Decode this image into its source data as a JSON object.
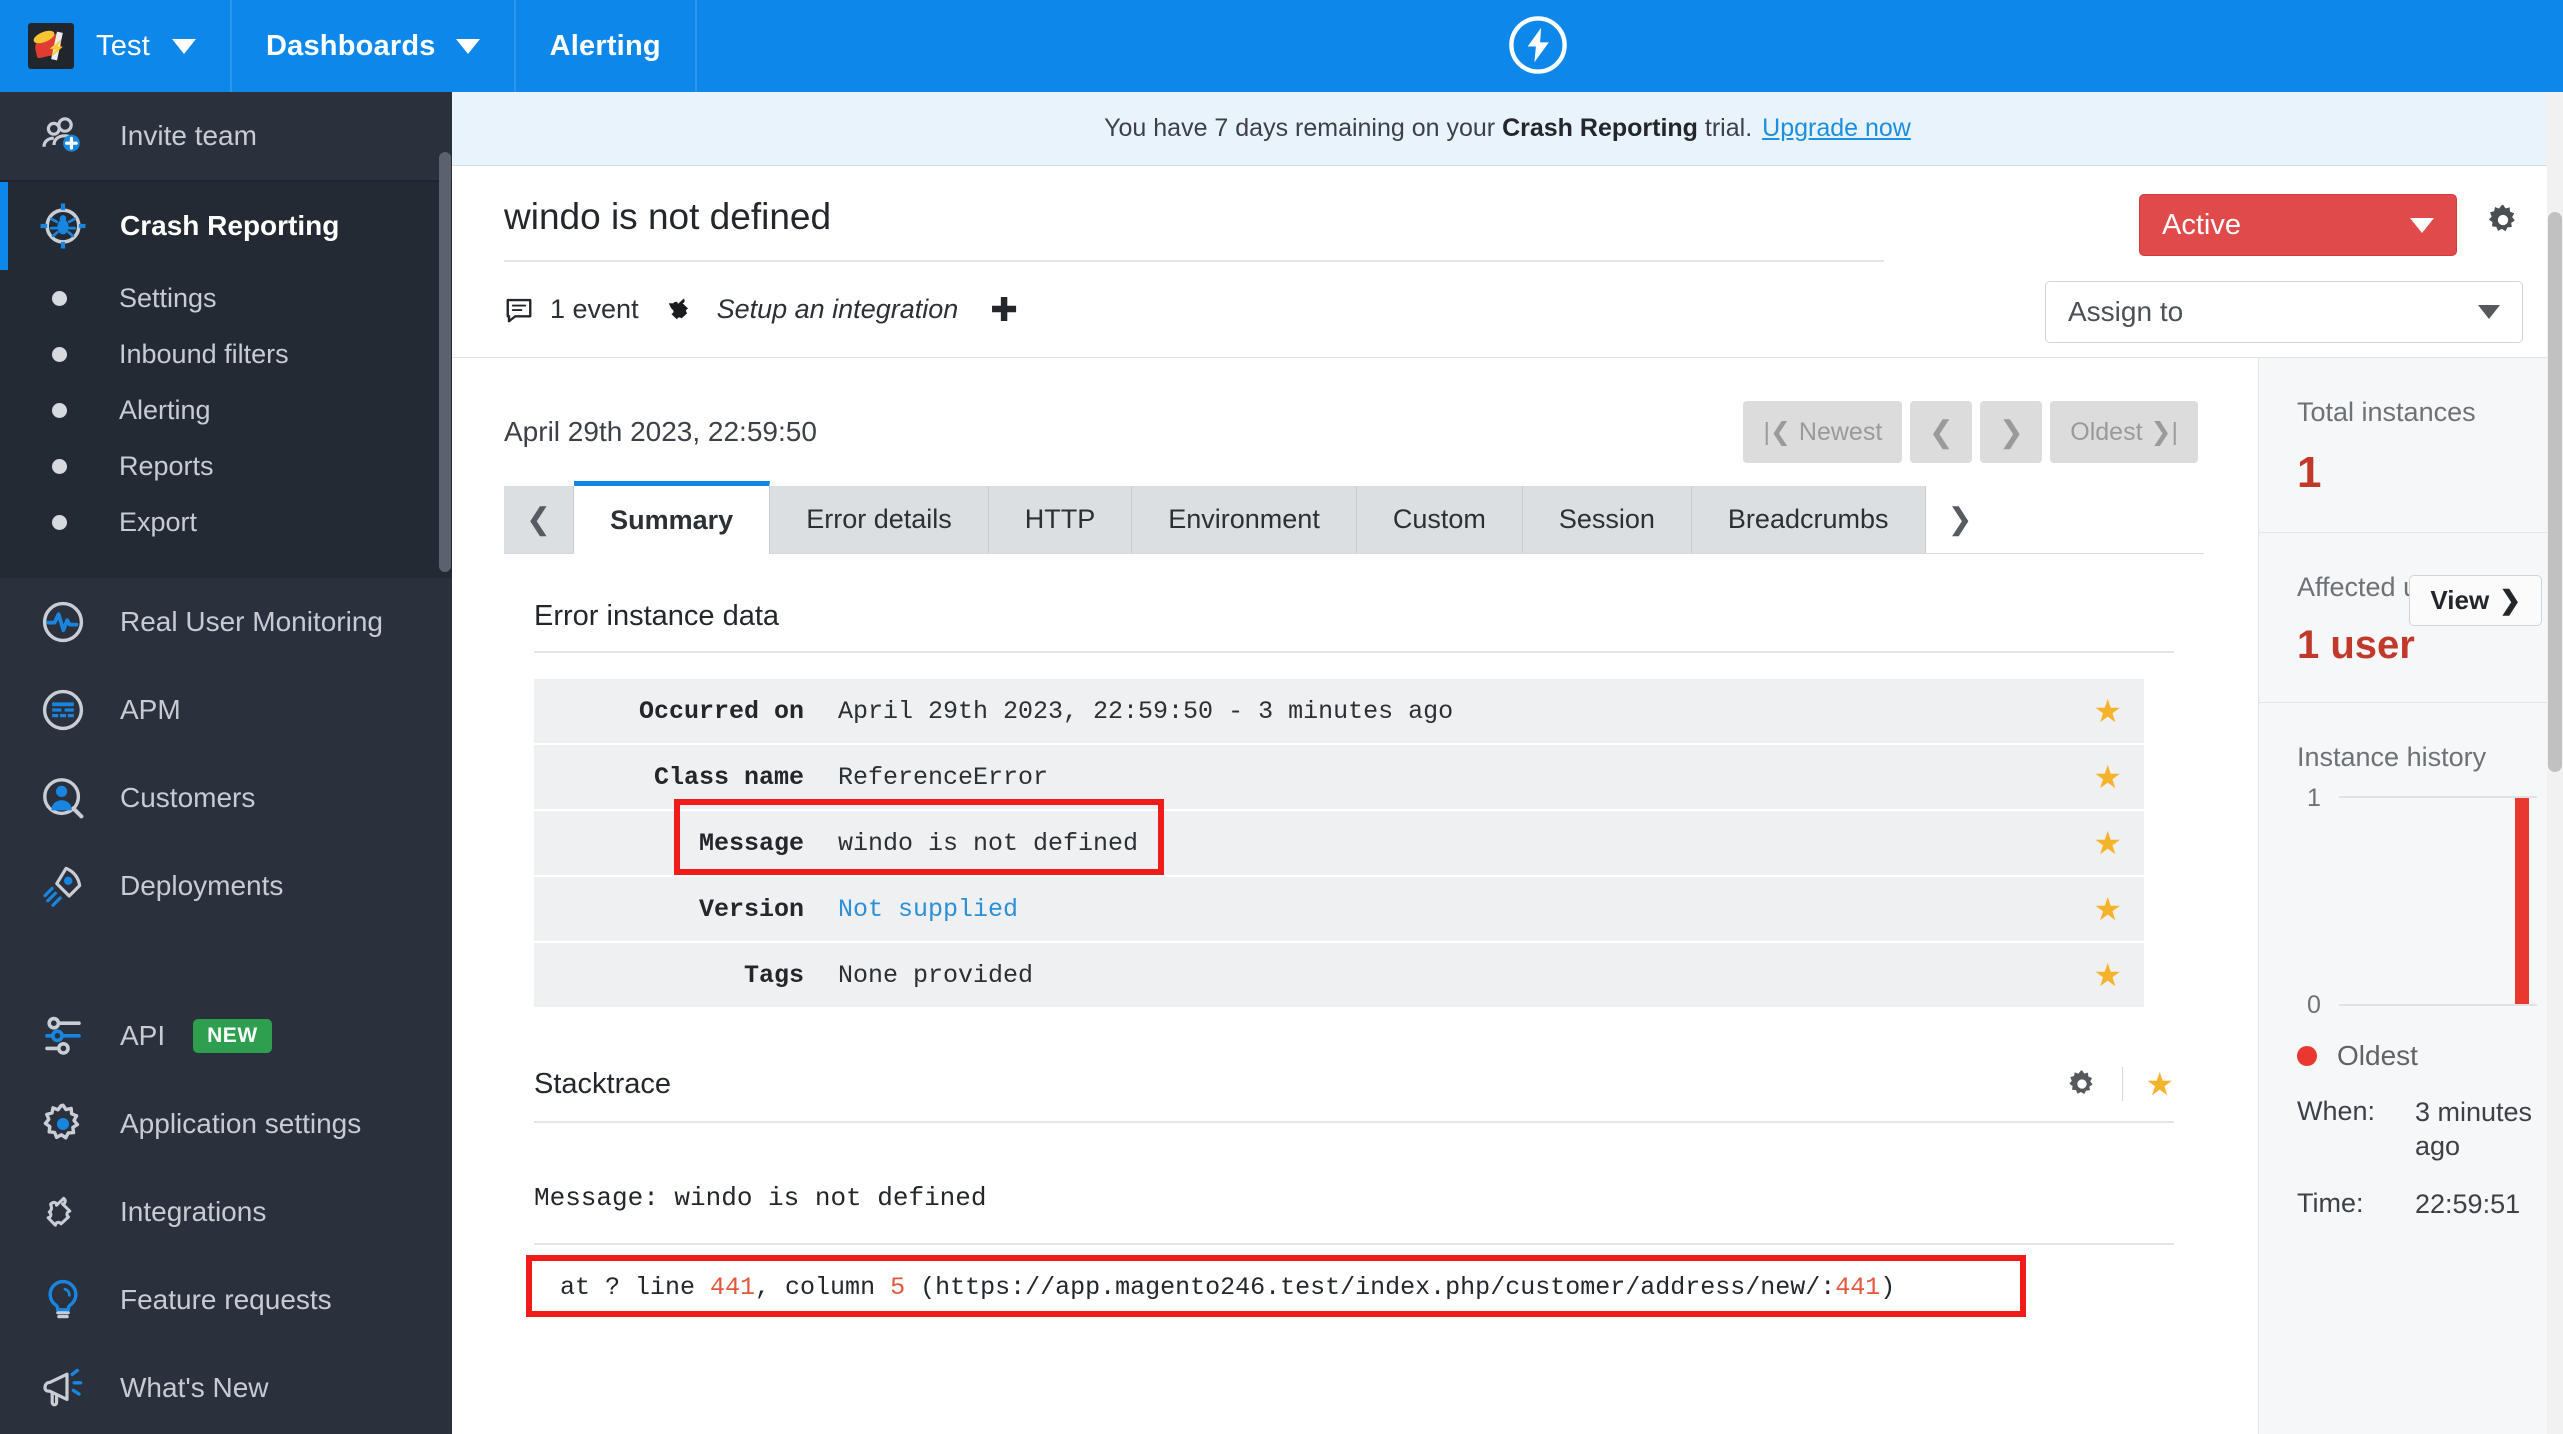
{
  "topnav": {
    "brand_icon": "raygun-logo-icon",
    "items": [
      {
        "label": "Test",
        "caret": true
      },
      {
        "label": "Dashboards",
        "caret": true
      },
      {
        "label": "Alerting",
        "caret": false
      }
    ],
    "center_logo_icon": "bolt-circle-icon"
  },
  "sidebar": {
    "invite": {
      "label": "Invite team",
      "icon": "invite-team-icon"
    },
    "crash_reporting": {
      "label": "Crash Reporting",
      "icon": "crash-reporting-bug-icon"
    },
    "crash_sub_items": [
      {
        "label": "Settings"
      },
      {
        "label": "Inbound filters"
      },
      {
        "label": "Alerting"
      },
      {
        "label": "Reports"
      },
      {
        "label": "Export"
      }
    ],
    "products": [
      {
        "label": "Real User Monitoring",
        "icon": "pulse-circle-icon"
      },
      {
        "label": "APM",
        "icon": "apm-circle-icon"
      },
      {
        "label": "Customers",
        "icon": "customers-icon"
      },
      {
        "label": "Deployments",
        "icon": "rocket-icon"
      }
    ],
    "tools": [
      {
        "label": "API",
        "icon": "api-sliders-icon",
        "badge": "NEW"
      },
      {
        "label": "Application settings",
        "icon": "gear-icon",
        "badge": ""
      },
      {
        "label": "Integrations",
        "icon": "puzzle-icon",
        "badge": ""
      },
      {
        "label": "Feature requests",
        "icon": "lightbulb-icon",
        "badge": ""
      },
      {
        "label": "What's New",
        "icon": "megaphone-icon",
        "badge": ""
      }
    ]
  },
  "banner": {
    "text_before": "You have 7 days remaining on your",
    "product": "Crash Reporting",
    "text_after": "trial.",
    "link": "Upgrade now"
  },
  "header": {
    "title": "windo is not defined",
    "event_count": "1 event",
    "event_icon": "comment-icon",
    "integration_label": "Setup an integration",
    "integration_icon": "puzzle-icon",
    "plus_icon": "plus-icon",
    "status": "Active",
    "gear_icon": "gear-icon",
    "assign_placeholder": "Assign to"
  },
  "instance_nav": {
    "date": "April 29th 2023, 22:59:50",
    "newest": "Newest",
    "oldest": "Oldest",
    "prev_icon": "chevron-left-icon",
    "next_icon": "chevron-right-icon"
  },
  "tabs": {
    "left_arrow": "chevron-left-icon",
    "right_arrow": "chevron-right-icon",
    "items": [
      {
        "label": "Summary",
        "active": true
      },
      {
        "label": "Error details",
        "active": false
      },
      {
        "label": "HTTP",
        "active": false
      },
      {
        "label": "Environment",
        "active": false
      },
      {
        "label": "Custom",
        "active": false
      },
      {
        "label": "Session",
        "active": false
      },
      {
        "label": "Breadcrumbs",
        "active": false
      }
    ]
  },
  "error_instance": {
    "title": "Error instance data",
    "rows": [
      {
        "key": "Occurred on",
        "value": "April 29th 2023, 22:59:50 - 3 minutes ago",
        "link": false,
        "highlighted": false
      },
      {
        "key": "Class name",
        "value": "ReferenceError",
        "link": false,
        "highlighted": false
      },
      {
        "key": "Message",
        "value": "windo is not defined",
        "link": false,
        "highlighted": true
      },
      {
        "key": "Version",
        "value": "Not supplied",
        "link": true,
        "highlighted": false
      },
      {
        "key": "Tags",
        "value": "None provided",
        "link": false,
        "highlighted": false
      }
    ],
    "star_icon": "star-icon"
  },
  "stacktrace": {
    "title": "Stacktrace",
    "gear_icon": "gear-icon",
    "star_icon": "star-icon",
    "message": "Message: windo is not defined",
    "frame_prefix": "at ? line ",
    "frame_line": "441",
    "frame_mid": ", column ",
    "frame_column": "5",
    "frame_url_open": " (https://app.magento246.test/index.php/customer/address/new/:",
    "frame_url_line": "441",
    "frame_close": ")"
  },
  "side_stats": {
    "total_instances_label": "Total instances",
    "total_instances_value": "1",
    "affected_users_label": "Affected users",
    "affected_users_value": "1 user",
    "view_button": "View",
    "view_chevron_icon": "chevron-right-icon",
    "history_label": "Instance history",
    "legend_label": "Oldest",
    "when_key": "When:",
    "when_value": "3 minutes ago",
    "time_key": "Time:",
    "time_value": "22:59:51"
  },
  "chart_data": {
    "type": "bar",
    "title": "Instance history",
    "categories": [
      "Oldest"
    ],
    "values": [
      1
    ],
    "ylim": [
      0,
      1
    ],
    "ytick_labels": [
      "0",
      "1"
    ],
    "xlabel": "",
    "ylabel": "",
    "grid": true,
    "series_color": "#e8382f",
    "legend": [
      "Oldest"
    ],
    "legend_position": "below"
  },
  "colors": {
    "nav_blue": "#0d87e9",
    "sidebar_dark": "#2a313c",
    "status_red": "#e04a4a",
    "accent_red": "#c0392b",
    "highlight_red": "#f01c1c",
    "badge_green": "#2e9e4f",
    "star_yellow": "#f5b32b",
    "link_blue": "#2b90d9"
  }
}
